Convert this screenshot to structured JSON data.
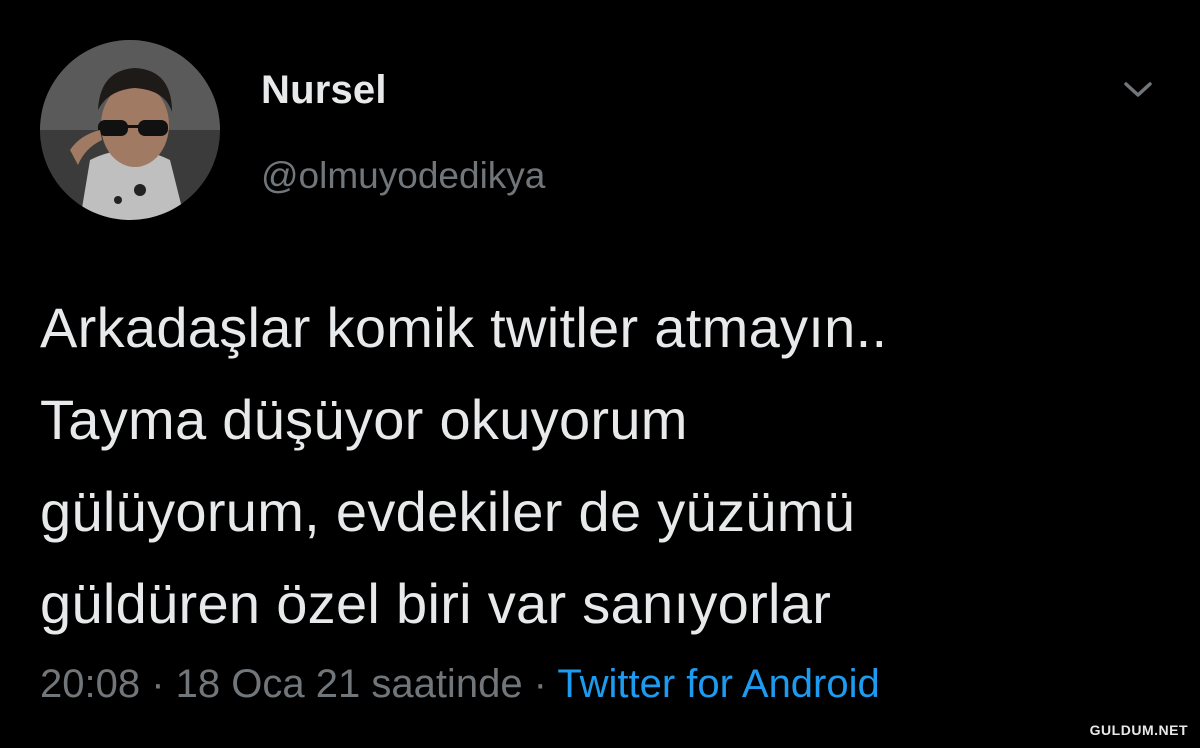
{
  "tweet": {
    "author": {
      "display_name": "Nursel",
      "handle": "@olmuyodedikya",
      "avatar_icon": "profile-photo"
    },
    "menu_icon": "chevron-down-icon",
    "text": "Arkadaşlar komik twitler atmayın..\nTayma düşüyor okuyorum\ngülüyorum, evdekiler de yüzümü\ngüldüren özel biri var sanıyorlar",
    "meta": {
      "time_date": "20:08 · 18 Oca 21 saatinde",
      "separator": " · ",
      "source": "Twitter for Android"
    }
  },
  "watermark": "GULDUM.NET",
  "colors": {
    "background": "#000000",
    "primary_text": "#e7e9ea",
    "secondary_text": "#71767b",
    "link": "#1d9bf0"
  }
}
